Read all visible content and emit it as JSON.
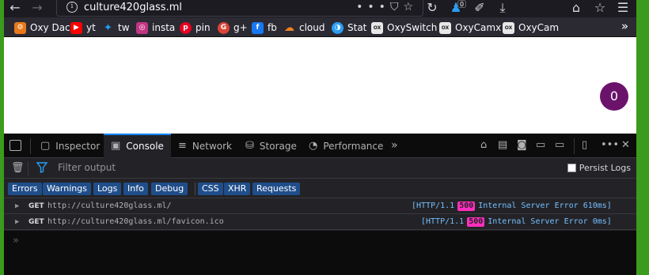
{
  "browser": {
    "url": "culture420glass.ml",
    "notification_count": "0"
  },
  "bookmarks": [
    {
      "label": "Oxy Dac",
      "icon": "oxydac-icon",
      "color": "#e8781a"
    },
    {
      "label": "yt",
      "icon": "youtube-icon",
      "color": "#ff0000"
    },
    {
      "label": "tw",
      "icon": "twitter-icon",
      "color": "#1da1f2"
    },
    {
      "label": "insta",
      "icon": "instagram-icon",
      "color": "#c13584"
    },
    {
      "label": "pin",
      "icon": "pinterest-icon",
      "color": "#e60023"
    },
    {
      "label": "g+",
      "icon": "google-plus-icon",
      "color": "#db4437"
    },
    {
      "label": "fb",
      "icon": "facebook-icon",
      "color": "#1877f2"
    },
    {
      "label": "cloud",
      "icon": "cloudflare-icon",
      "color": "#f38020"
    },
    {
      "label": "Stat",
      "icon": "stat-icon",
      "color": "#2a9df4"
    },
    {
      "label": "OxySwitch",
      "icon": "oxy-switch-icon",
      "color": "#222222"
    },
    {
      "label": "OxyCamx",
      "icon": "oxy-camx-icon",
      "color": "#222222"
    },
    {
      "label": "OxyCam",
      "icon": "oxy-cam-icon",
      "color": "#222222"
    }
  ],
  "page": {
    "counter": "0"
  },
  "devtools": {
    "tabs": [
      "Inspector",
      "Console",
      "Network",
      "Storage",
      "Performance"
    ],
    "active_tab": "Console",
    "filter_placeholder": "Filter output",
    "persist_logs": "Persist Logs",
    "levels": [
      "Errors",
      "Warnings",
      "Logs",
      "Info",
      "Debug"
    ],
    "extra_filters": [
      "CSS",
      "XHR",
      "Requests"
    ],
    "logs": [
      {
        "method": "GET",
        "url": "http://culture420glass.ml/",
        "proto": "[HTTP/1.1",
        "code": "500",
        "message": "Internal Server Error 610ms]"
      },
      {
        "method": "GET",
        "url": "http://culture420glass.ml/favicon.ico",
        "proto": "[HTTP/1.1",
        "code": "500",
        "message": "Internal Server Error 0ms]"
      }
    ],
    "prompt": "»"
  }
}
